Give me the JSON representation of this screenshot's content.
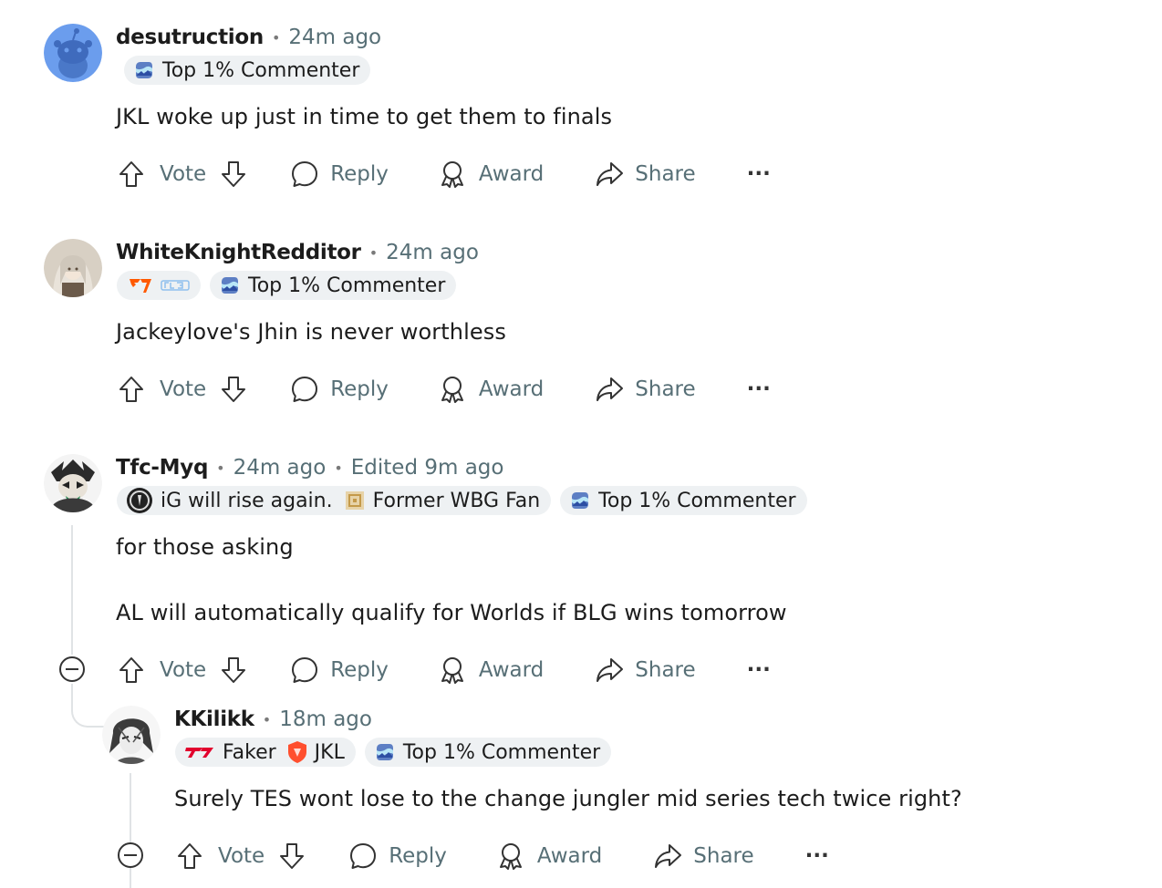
{
  "comments": [
    {
      "username": "desutruction",
      "time": "24m ago",
      "edited": "",
      "flairs": [
        {
          "text": "Top 1% Commenter",
          "icon": "top-commenter-icon"
        }
      ],
      "text": [
        "JKL woke up just in time to get them to finals"
      ]
    },
    {
      "username": "WhiteKnightRedditor",
      "time": "24m ago",
      "edited": "",
      "flairs": [
        {
          "text": "",
          "icon": "fnatic-blg-logo"
        },
        {
          "text": "Top 1% Commenter",
          "icon": "top-commenter-icon"
        }
      ],
      "text": [
        "Jackeylove's Jhin is never worthless"
      ]
    },
    {
      "username": "Tfc-Myq",
      "time": "24m ago",
      "edited": "Edited 9m ago",
      "flairs": [
        {
          "text": "iG will rise again.",
          "text2": "Former WBG Fan",
          "icon": "ig-logo",
          "icon2": "wbg-logo"
        },
        {
          "text": "Top 1% Commenter",
          "icon": "top-commenter-icon"
        }
      ],
      "text": [
        "for those asking",
        "AL will automatically qualify for Worlds if BLG wins tomorrow"
      ]
    },
    {
      "username": "KKilikk",
      "time": "18m ago",
      "edited": "",
      "flairs": [
        {
          "text": "Faker",
          "text2": "JKL",
          "icon": "t1-logo",
          "icon2": "tes-logo"
        },
        {
          "text": "Top 1% Commenter",
          "icon": "top-commenter-icon"
        }
      ],
      "text": [
        "Surely TES wont lose to the change jungler mid series tech twice right?"
      ]
    }
  ],
  "actions": {
    "vote": "Vote",
    "reply": "Reply",
    "award": "Award",
    "share": "Share",
    "more": "···"
  },
  "colors": {
    "meta_gray": "#576f76",
    "flair_bg": "#eef1f3",
    "thread_line": "#e0e3e5"
  }
}
